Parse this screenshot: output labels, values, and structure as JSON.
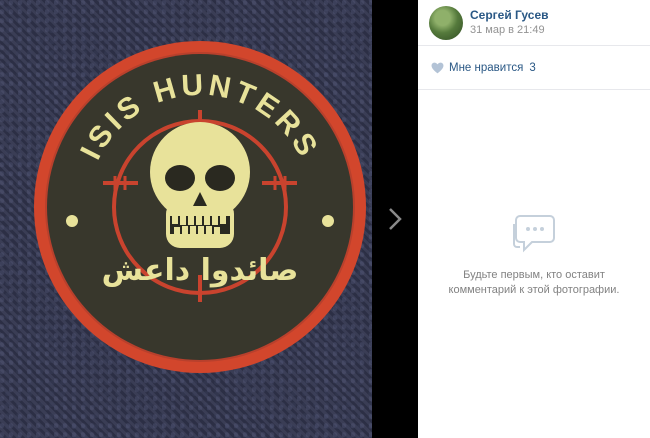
{
  "author": {
    "name": "Сергей Гусев",
    "date": "31 мар в 21:49",
    "avatar_icon": "avatar-photo"
  },
  "likes": {
    "label": "Мне нравится",
    "count": "3",
    "icon": "heart-icon"
  },
  "comments": {
    "empty_text": "Будьте первым, кто оставит комментарий к этой фотографии.",
    "icon": "comment-bubble-icon"
  },
  "photo": {
    "patch_top_text": "ISIS HUNTERS",
    "patch_bottom_text": "صائدوا داعش"
  },
  "colors": {
    "link": "#2a5885",
    "muted": "#939393",
    "patch_red": "#d2462c",
    "patch_yellow": "#e8e29a",
    "patch_dark": "#38372c"
  }
}
